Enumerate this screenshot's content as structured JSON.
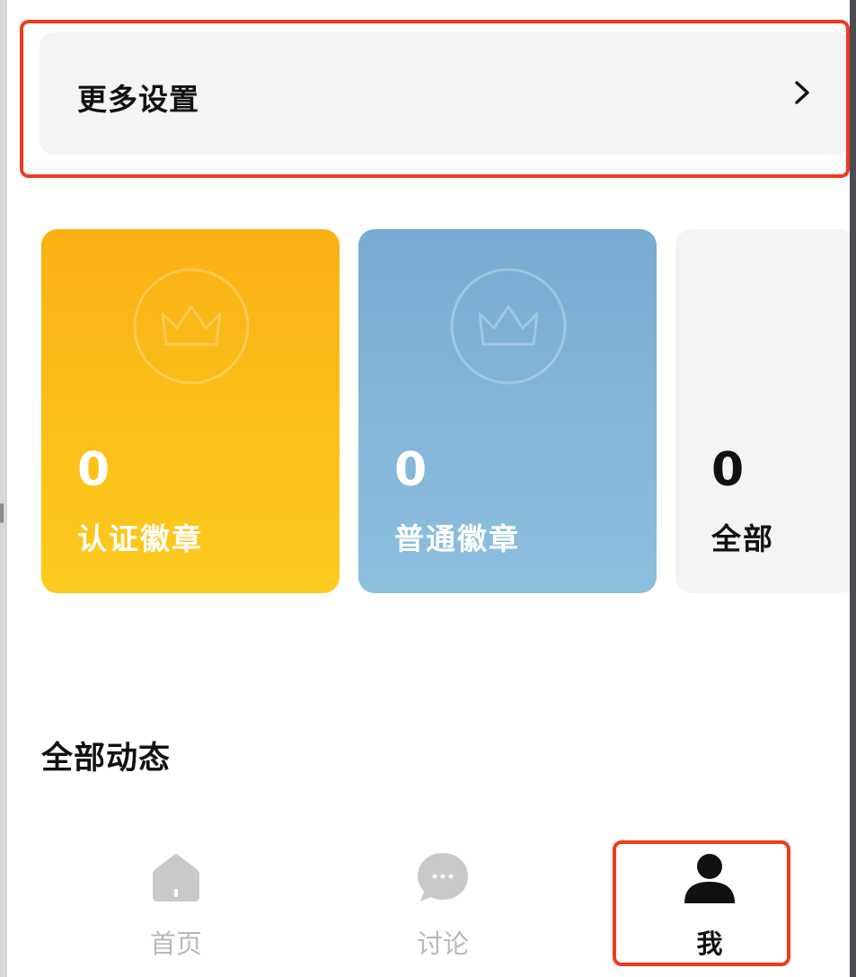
{
  "settings": {
    "label": "更多设置"
  },
  "badges": [
    {
      "count": "0",
      "title": "认证徽章",
      "color": "#f9b112"
    },
    {
      "count": "0",
      "title": "普通徽章",
      "color": "#78abd0"
    },
    {
      "count": "0",
      "title": "全部",
      "color": "#f4f4f5"
    }
  ],
  "feed": {
    "title": "全部动态"
  },
  "tabbar": {
    "items": [
      {
        "label": "首页",
        "icon": "home-icon",
        "active": false
      },
      {
        "label": "讨论",
        "icon": "chat-bubble-icon",
        "active": false
      },
      {
        "label": "我",
        "icon": "user-icon",
        "active": true
      }
    ]
  },
  "highlight_color": "#f23a20"
}
